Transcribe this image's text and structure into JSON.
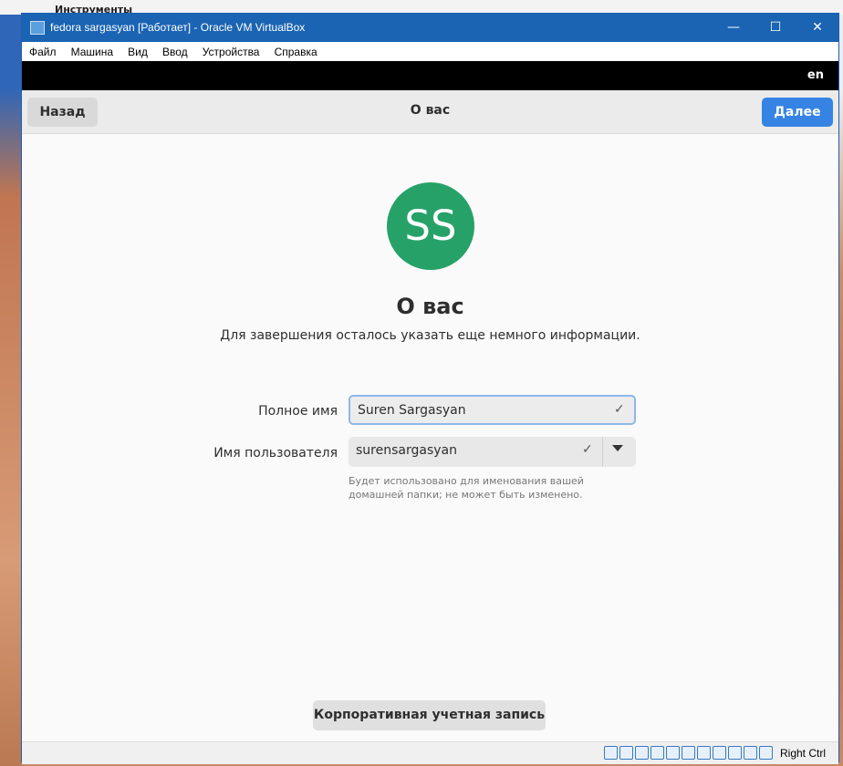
{
  "host": {
    "toolbar_label": "Инструменты"
  },
  "window": {
    "title": "fedora sargasyan [Работает] - Oracle VM VirtualBox",
    "controls": {
      "minimize": "—",
      "maximize": "☐",
      "close": "✕"
    }
  },
  "menu": [
    "Файл",
    "Машина",
    "Вид",
    "Ввод",
    "Устройства",
    "Справка"
  ],
  "gnome_top": {
    "language": "en"
  },
  "header": {
    "back_label": "Назад",
    "title": "О вас",
    "next_label": "Далее"
  },
  "page": {
    "avatar_initials": "SS",
    "heading": "О вас",
    "subheading": "Для завершения осталось указать еще немного информации.",
    "full_name": {
      "label": "Полное имя",
      "value": "Suren Sargasyan"
    },
    "username": {
      "label": "Имя пользователя",
      "value": "surensargasyan",
      "hint": "Будет использовано для именования вашей домашней папки; не может быть изменено."
    },
    "enterprise_button": "Корпоративная учетная запись"
  },
  "statusbar": {
    "host_key": "Right Ctrl"
  },
  "colors": {
    "accent": "#3584e4",
    "avatar": "#26a269",
    "titlebar": "#1a64b3"
  },
  "icons": [
    "hard-disk-icon",
    "optical-drive-icon",
    "audio-icon",
    "network-icon",
    "usb-icon",
    "shared-folder-icon",
    "display-icon",
    "recording-icon",
    "cpu-icon",
    "mouse-icon",
    "keyboard-icon"
  ]
}
